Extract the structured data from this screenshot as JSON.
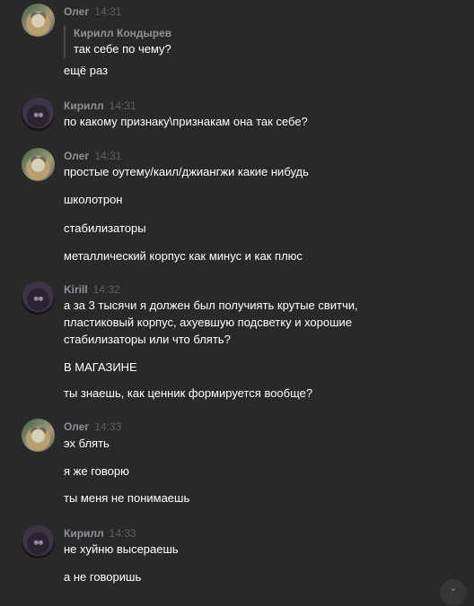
{
  "messages": [
    {
      "author": "Олег",
      "time": "14:31",
      "avatar": "oleg-avatar",
      "quote": {
        "author": "Кирилл Кондырев",
        "text": "так себе по чему?"
      },
      "lines": [
        "ещё раз"
      ]
    },
    {
      "author": "Кирилл",
      "time": "14:31",
      "avatar": "kirill-avatar",
      "lines": [
        "по какому признаку\\признакам она так себе?"
      ]
    },
    {
      "author": "Олег",
      "time": "14:31",
      "avatar": "oleg-avatar",
      "lines": [
        "простые оутему/каил/джиангжи какие нибудь",
        "школотрон",
        "стабилизаторы",
        "металлический корпус как минус и как плюс"
      ]
    },
    {
      "author": "Kirill",
      "time": "14:32",
      "avatar": "kirill-avatar",
      "lines": [
        "а за 3 тысячи я должен был получиять крутые свитчи,",
        "пластиковый корпус, ахуевшую подсветку и хорошие",
        "стабилизаторы или что блять?",
        "В МАГАЗИНЕ",
        "ты знаешь, как ценник формируется вообще?"
      ]
    },
    {
      "author": "Олег",
      "time": "14:33",
      "avatar": "oleg-avatar",
      "lines": [
        "эх блять",
        "я же говорю",
        "ты меня не понимаешь"
      ]
    },
    {
      "author": "Кирилл",
      "time": "14:33",
      "avatar": "kirill-avatar",
      "lines": [
        "не хуйню высераешь",
        "а не говоришь"
      ]
    }
  ],
  "scroll_button": {
    "icon": "chevron-down-icon",
    "glyph": "⌄"
  }
}
